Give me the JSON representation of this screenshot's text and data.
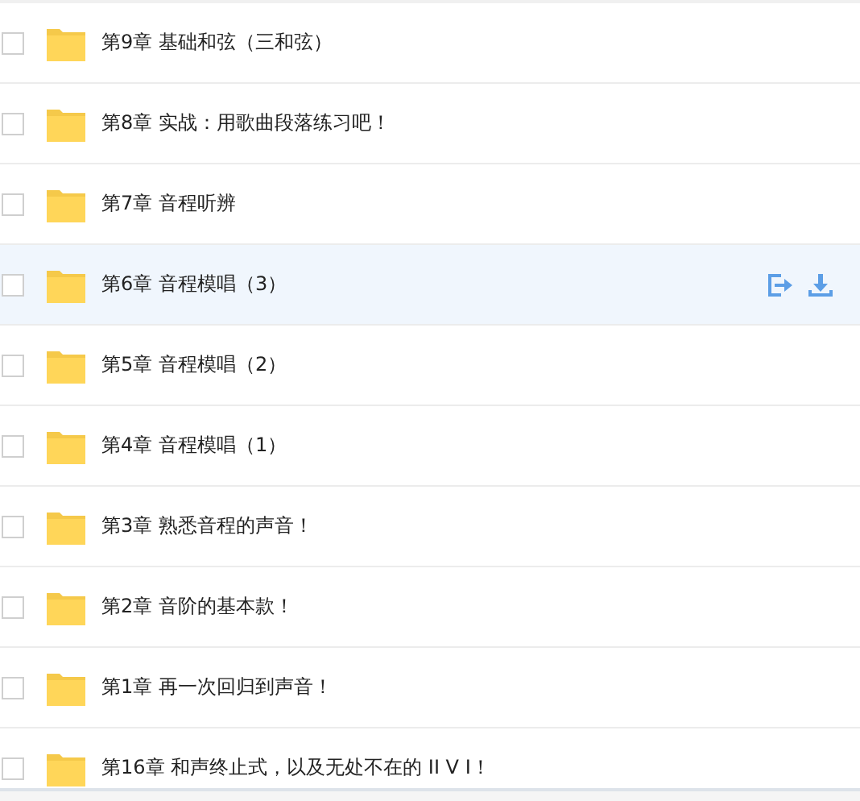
{
  "files": [
    {
      "name": "第9章  基础和弦（三和弦）",
      "selected": false
    },
    {
      "name": "第8章  实战：用歌曲段落练习吧！",
      "selected": false
    },
    {
      "name": "第7章  音程听辨",
      "selected": false
    },
    {
      "name": "第6章  音程模唱（3）",
      "selected": true
    },
    {
      "name": "第5章  音程模唱（2）",
      "selected": false
    },
    {
      "name": "第4章  音程模唱（1）",
      "selected": false
    },
    {
      "name": "第3章  熟悉音程的声音！",
      "selected": false
    },
    {
      "name": "第2章  音阶的基本款！",
      "selected": false
    },
    {
      "name": "第1章  再一次回归到声音！",
      "selected": false
    },
    {
      "name": "第16章  和声终止式，以及无处不在的 II V I！",
      "selected": false
    }
  ]
}
